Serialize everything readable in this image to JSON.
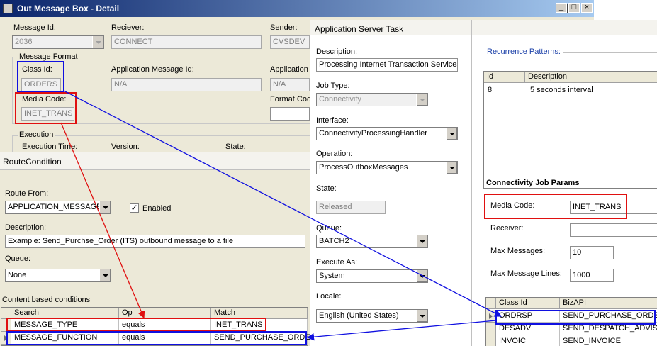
{
  "outbox": {
    "title": "Out Message Box - Detail",
    "message_id_label": "Message Id:",
    "message_id_value": "2036",
    "reciever_label": "Reciever:",
    "reciever_value": "CONNECT",
    "sender_label": "Sender:",
    "sender_value": "CVSDEV",
    "format_group": "Message Format",
    "class_id_label": "Class Id:",
    "class_id_value": "ORDERS",
    "app_msg_id_label": "Application Message Id:",
    "app_msg_id_value": "N/A",
    "application_label": "Application",
    "application_value": "N/A",
    "media_code_label": "Media Code:",
    "media_code_value": "INET_TRANS",
    "format_code_label": "Format Cod",
    "execution_group": "Execution",
    "execution_time_label": "Execution Time:",
    "version_label": "Version:",
    "state_label": "State:"
  },
  "route": {
    "title": "RouteCondition",
    "route_from_label": "Route From:",
    "route_from_value": "APPLICATION_MESSAGE",
    "enabled_label": "Enabled",
    "enabled_mark": "✓",
    "description_label": "Description:",
    "description_value": "Example: Send_Purchse_Order (ITS) outbound message to a file",
    "queue_label": "Queue:",
    "queue_value": "None",
    "conditions_label": "Content based conditions",
    "columns": [
      "Search",
      "Op",
      "Match"
    ],
    "rows": [
      [
        "MESSAGE_TYPE",
        "equals",
        "INET_TRANS"
      ],
      [
        "MESSAGE_FUNCTION",
        "equals",
        "SEND_PURCHASE_ORDER"
      ]
    ]
  },
  "task": {
    "title": "Application Server Task",
    "description_label": "Description:",
    "description_value": "Processing Internet Transaction Services",
    "job_type_label": "Job Type:",
    "job_type_value": "Connectivity",
    "interface_label": "Interface:",
    "interface_value": "ConnectivityProcessingHandler",
    "operation_label": "Operation:",
    "operation_value": "ProcessOutboxMessages",
    "state_label": "State:",
    "state_value": "Released",
    "queue_label": "Queue:",
    "queue_value": "BATCH2",
    "execute_as_label": "Execute As:",
    "execute_as_value": "System",
    "locale_label": "Locale:",
    "locale_value": "English (United States)"
  },
  "recurrence": {
    "link": "Recurrence Patterns:",
    "columns": [
      "Id",
      "Description"
    ],
    "rows": [
      [
        "8",
        "5 seconds interval"
      ]
    ]
  },
  "params": {
    "title": "Connectivity Job Params",
    "media_code_label": "Media Code:",
    "media_code_value": "INET_TRANS",
    "receiver_label": "Receiver:",
    "receiver_value": "",
    "max_messages_label": "Max Messages:",
    "max_messages_value": "10",
    "max_lines_label": "Max Message Lines:",
    "max_lines_value": "1000",
    "columns": [
      "Class Id",
      "BizAPI"
    ],
    "rows": [
      [
        "ORDRSP",
        "SEND_PURCHASE_ORDER"
      ],
      [
        "DESADV",
        "SEND_DESPATCH_ADVISE"
      ],
      [
        "INVOIC",
        "SEND_INVOICE"
      ]
    ]
  },
  "colors": {
    "highlight_red": "#e01010",
    "highlight_blue": "#1010e0",
    "title_bar": "#0a246a"
  }
}
